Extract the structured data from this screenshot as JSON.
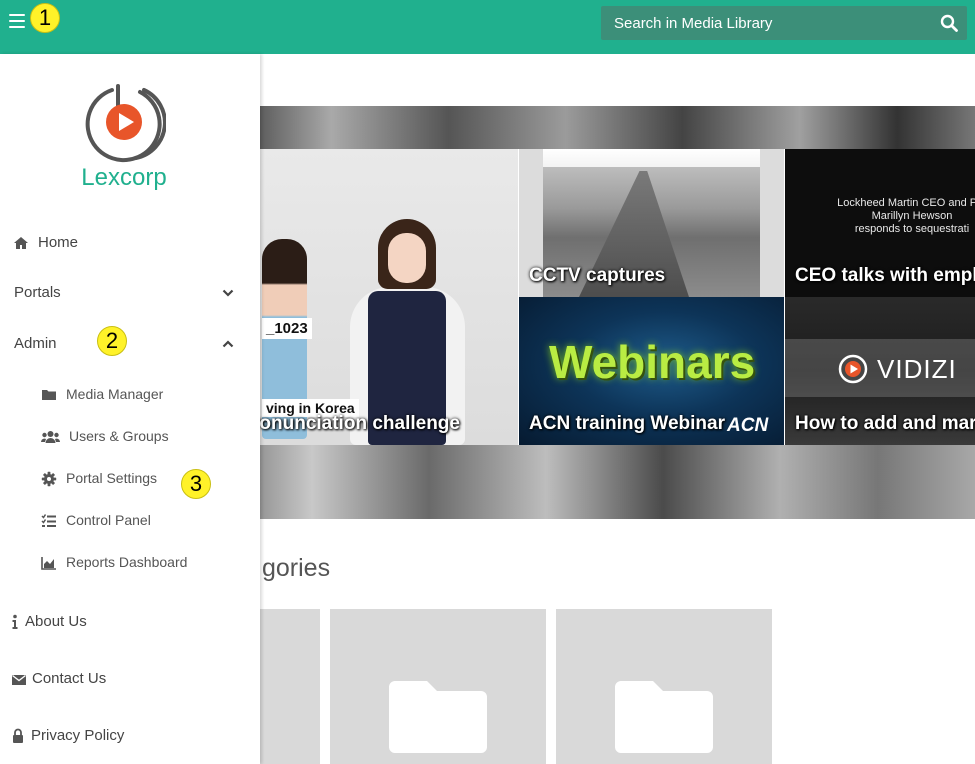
{
  "topbar": {
    "menu_icon": "hamburger-icon",
    "search_placeholder": "Search in Media Library",
    "search_icon": "search-icon",
    "background": "#20b08e"
  },
  "callouts": [
    "1",
    "2",
    "3"
  ],
  "sidebar": {
    "brand": "Lexcorp",
    "logo_icon": "play-circle-logo",
    "accent": "#20b08e",
    "items": [
      {
        "label": "Home",
        "icon": "home-icon"
      },
      {
        "label": "Portals",
        "icon": "",
        "chevron": "chevron-down-icon"
      },
      {
        "label": "Admin",
        "icon": "",
        "chevron": "chevron-up-icon"
      },
      {
        "label": "Media Manager",
        "icon": "folder-icon"
      },
      {
        "label": "Users & Groups",
        "icon": "users-icon"
      },
      {
        "label": "Portal Settings",
        "icon": "gear-icon"
      },
      {
        "label": "Control Panel",
        "icon": "list-check-icon"
      },
      {
        "label": "Reports Dashboard",
        "icon": "area-chart-icon"
      },
      {
        "label": "About Us",
        "icon": "info-icon"
      },
      {
        "label": "Contact Us",
        "icon": "envelope-icon"
      },
      {
        "label": "Privacy Policy",
        "icon": "lock-icon"
      }
    ]
  },
  "featured": {
    "tiles": [
      {
        "title": "ronunciation challenge",
        "overlay_tag_1": "_1023",
        "overlay_tag_2": "ving in Korea"
      },
      {
        "title": "CCTV captures"
      },
      {
        "title": "CEO talks with empl",
        "slide_text": "Lockheed Martin CEO and Pre\nMarillyn Hewson\nresponds to sequestrati"
      },
      {
        "title": "ACN training Webinar",
        "art_text": "Webinars",
        "logo_text": "ACN"
      },
      {
        "title": "How to add and mar",
        "logo_text": "VIDIZI"
      }
    ]
  },
  "categories": {
    "title": "gories",
    "cards": [
      "folder-icon",
      "folder-icon",
      "folder-icon"
    ]
  }
}
